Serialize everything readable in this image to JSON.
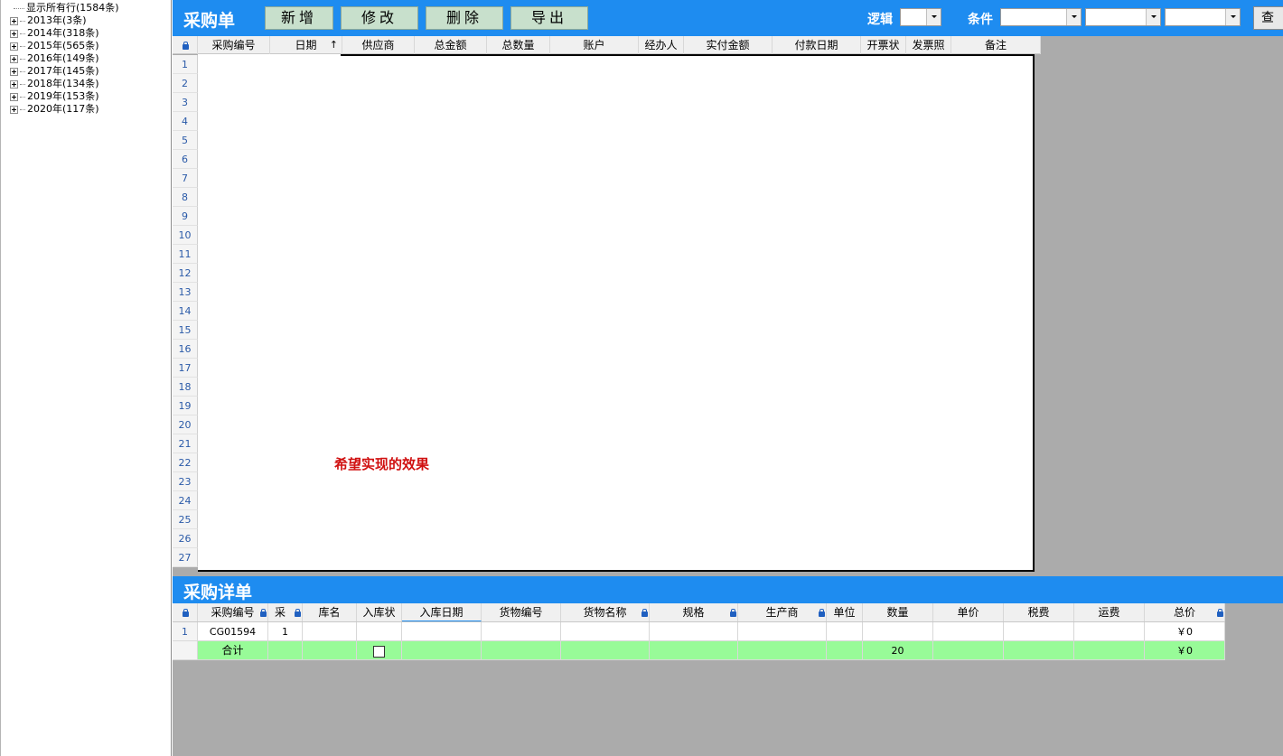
{
  "tree": {
    "items": [
      {
        "label": "显示所有行(1584条)",
        "leaf": true
      },
      {
        "label": "2013年(3条)",
        "leaf": false
      },
      {
        "label": "2014年(318条)",
        "leaf": false
      },
      {
        "label": "2015年(565条)",
        "leaf": false
      },
      {
        "label": "2016年(149条)",
        "leaf": false
      },
      {
        "label": "2017年(145条)",
        "leaf": false
      },
      {
        "label": "2018年(134条)",
        "leaf": false
      },
      {
        "label": "2019年(153条)",
        "leaf": false
      },
      {
        "label": "2020年(117条)",
        "leaf": false
      }
    ]
  },
  "toolbar": {
    "title": "采购单",
    "add_label": "新增",
    "edit_label": "修改",
    "delete_label": "删除",
    "export_label": "导出",
    "logic_label": "逻辑",
    "condition_label": "条件",
    "query_label": "查"
  },
  "order_grid": {
    "columns": [
      "采购编号",
      "日期",
      "供应商",
      "总金额",
      "总数量",
      "账户",
      "经办人",
      "实付金额",
      "付款日期",
      "开票状",
      "发票照",
      "备注"
    ],
    "sort_indicator": "↑",
    "row_numbers": [
      "1",
      "2",
      "3",
      "4",
      "5",
      "6",
      "7",
      "8",
      "9",
      "10",
      "11",
      "12",
      "13",
      "14",
      "15",
      "16",
      "17",
      "18",
      "19",
      "20",
      "21",
      "22",
      "23",
      "24",
      "25",
      "26",
      "27"
    ],
    "annotation": "希望实现的效果"
  },
  "detail": {
    "title": "采购详单",
    "columns": [
      "采购编号",
      "采",
      "库名",
      "入库状",
      "入库日期",
      "货物编号",
      "货物名称",
      "规格",
      "生产商",
      "单位",
      "数量",
      "单价",
      "税费",
      "运费",
      "总价"
    ],
    "row": {
      "num": "1",
      "code": "CG01594",
      "seq": "1",
      "total": "￥0"
    },
    "sum_row": {
      "label": "合计",
      "qty": "20",
      "total": "￥0"
    },
    "sum_row_color": "#98fb98"
  },
  "colors": {
    "accent": "#1e8cf0",
    "button_bg": "#c8e0cc",
    "annotation": "#d01010"
  }
}
